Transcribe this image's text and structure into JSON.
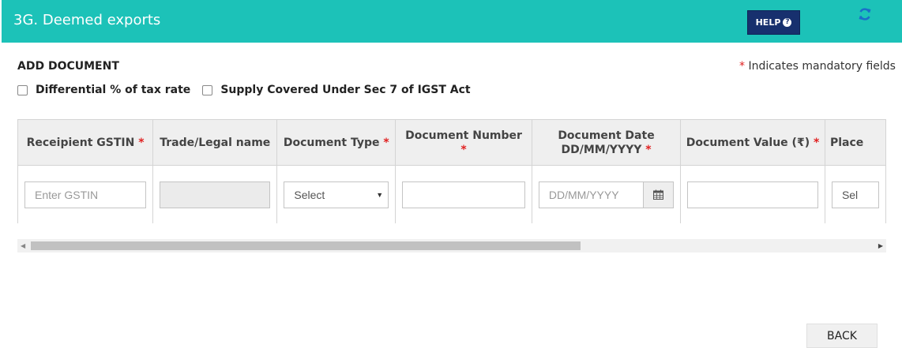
{
  "header": {
    "title": "3G. Deemed exports",
    "help_label": "HELP",
    "help_icon": "question-circle-icon",
    "refresh_icon": "refresh-icon",
    "bg_color": "#1cc2b8",
    "help_color": "#17306e"
  },
  "form": {
    "section_title": "ADD DOCUMENT",
    "mandatory_star": "*",
    "mandatory_note": "Indicates mandatory fields",
    "checkboxes": [
      {
        "label": "Differential % of tax rate",
        "checked": false
      },
      {
        "label": "Supply Covered Under Sec 7 of IGST Act",
        "checked": false
      }
    ]
  },
  "table": {
    "columns": [
      {
        "label": "Receipient GSTIN",
        "required": "*"
      },
      {
        "label": "Trade/Legal name",
        "required": ""
      },
      {
        "label": "Document Type",
        "required": "*"
      },
      {
        "label": "Document Number",
        "required": "*"
      },
      {
        "label": "Document Date",
        "label2": "DD/MM/YYYY",
        "required": "*"
      },
      {
        "label": "Document Value (₹)",
        "required": "*"
      },
      {
        "label": "Place",
        "required": ""
      }
    ],
    "row": {
      "gstin_placeholder": "Enter GSTIN",
      "trade_name_value": "",
      "document_type_selected": "Select",
      "document_number_value": "",
      "date_placeholder": "DD/MM/YYYY",
      "calendar_icon": "calendar-icon",
      "document_value": "",
      "place_selected": "Sel"
    }
  },
  "footer": {
    "back_label": "BACK"
  }
}
